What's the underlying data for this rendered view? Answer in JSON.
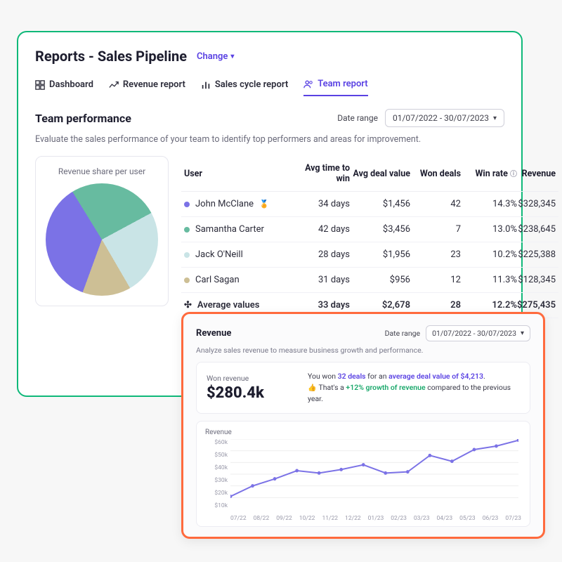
{
  "header": {
    "title": "Reports - Sales Pipeline",
    "change_label": "Change"
  },
  "tabs": [
    {
      "label": "Dashboard",
      "active": false
    },
    {
      "label": "Revenue report",
      "active": false
    },
    {
      "label": "Sales cycle report",
      "active": false
    },
    {
      "label": "Team report",
      "active": true
    }
  ],
  "team": {
    "title": "Team performance",
    "date_range_label": "Date range",
    "date_range_value": "01/07/2022 - 30/07/2023",
    "subtitle": "Evaluate the sales performance of your team to identify top performers and areas for improvement.",
    "pie_title": "Revenue share per user",
    "columns": {
      "user": "User",
      "avg_time": "Avg time to win",
      "avg_deal": "Avg deal value",
      "won": "Won deals",
      "win_rate": "Win rate",
      "revenue": "Revenue"
    },
    "rows": [
      {
        "color": "#7b72e6",
        "name": "John McClane",
        "medal": true,
        "avg_time": "34 days",
        "avg_deal": "$1,456",
        "won": "42",
        "win_rate": "14.3%",
        "revenue": "$328,345"
      },
      {
        "color": "#67bba0",
        "name": "Samantha Carter",
        "medal": false,
        "avg_time": "42 days",
        "avg_deal": "$3,456",
        "won": "7",
        "win_rate": "13.0%",
        "revenue": "$238,645"
      },
      {
        "color": "#c9e4e6",
        "name": "Jack O'Neill",
        "medal": false,
        "avg_time": "28 days",
        "avg_deal": "$1,956",
        "won": "23",
        "win_rate": "10.2%",
        "revenue": "$225,388"
      },
      {
        "color": "#cdbf95",
        "name": "Carl Sagan",
        "medal": false,
        "avg_time": "31 days",
        "avg_deal": "$956",
        "won": "12",
        "win_rate": "11.3%",
        "revenue": "$128,345"
      }
    ],
    "avg_row": {
      "name": "Average values",
      "avg_time": "33 days",
      "avg_deal": "$2,678",
      "won": "28",
      "win_rate": "12.2%",
      "revenue": "$275,435"
    }
  },
  "revenue": {
    "title": "Revenue",
    "date_range_label": "Date range",
    "date_range_value": "01/07/2022 - 30/07/2023",
    "subtitle": "Analyze sales revenue to measure business growth and performance.",
    "summary": {
      "label": "Won revenue",
      "value": "$280.4k",
      "line1_a": "You won ",
      "line1_deals": "32 deals",
      "line1_b": " for an ",
      "line1_avg": "average deal value of $4,213",
      "line1_c": ".",
      "line2_a": "That's a ",
      "line2_growth": "+12% growth of revenue",
      "line2_b": " compared to the previous year."
    },
    "chart_title": "Revenue"
  },
  "chart_data": [
    {
      "type": "pie",
      "title": "Revenue share per user",
      "series": [
        {
          "name": "John McClane",
          "value": 328345,
          "color": "#7b72e6"
        },
        {
          "name": "Samantha Carter",
          "value": 238645,
          "color": "#67bba0"
        },
        {
          "name": "Jack O'Neill",
          "value": 225388,
          "color": "#c9e4e6"
        },
        {
          "name": "Carl Sagan",
          "value": 128345,
          "color": "#cdbf95"
        }
      ]
    },
    {
      "type": "line",
      "title": "Revenue",
      "xlabel": "",
      "ylabel": "",
      "ylim": [
        0,
        60000
      ],
      "yticks": [
        "$10k",
        "$20k",
        "$30k",
        "$40k",
        "$50k",
        "$60k"
      ],
      "categories": [
        "07/22",
        "08/22",
        "09/22",
        "10/22",
        "11/22",
        "12/22",
        "01/23",
        "02/23",
        "03/23",
        "04/23",
        "05/23",
        "06/23",
        "07/23"
      ],
      "values": [
        11000,
        20000,
        26000,
        33000,
        31000,
        34000,
        38000,
        31000,
        32000,
        46000,
        41000,
        51000,
        54000,
        59000
      ]
    }
  ]
}
